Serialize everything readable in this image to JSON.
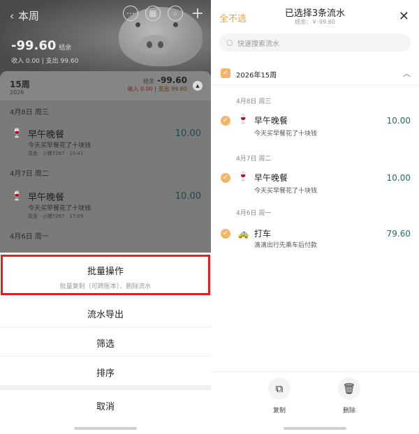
{
  "left": {
    "header": {
      "back_label": "本周",
      "balance": "-99.60",
      "balance_tag": "结余",
      "income": "收入 0.00",
      "expense": "支出 99.60",
      "icons": [
        "more-icon",
        "calendar-icon",
        "search-icon",
        "add-icon"
      ]
    },
    "week": {
      "title": "15周",
      "year": "2026",
      "balance_tag": "结余",
      "balance": "-99.60",
      "income": "收入 0.00",
      "expense": "支出 99.60"
    },
    "days": [
      {
        "label": "4月8日 周三",
        "entry": {
          "title": "早午晚餐",
          "note": "今天买早餐花了十块钱",
          "meta": "现金 · 小猪7287 · 10:41",
          "amount": "10.00"
        }
      },
      {
        "label": "4月7日 周二",
        "entry": {
          "title": "早午晚餐",
          "note": "今天买早餐花了十块钱",
          "meta": "现金 · 小猪7287 · 17:09",
          "amount": "10.00"
        }
      },
      {
        "label": "4月6日 周一"
      }
    ],
    "sheet": {
      "batch": "批量操作",
      "batch_desc": "批量复制（可跨账本）、删除流水",
      "export": "流水导出",
      "filter": "筛选",
      "sort": "排序",
      "cancel": "取消"
    }
  },
  "right": {
    "deselect_all": "全不选",
    "title": "已选择3条流水",
    "subtitle": "结余：￥-99.60",
    "search_placeholder": "快速搜索流水",
    "group_label": "2026年15周",
    "days": [
      {
        "label": "4月8日 周三",
        "title": "早午晚餐",
        "note": "今天买早餐花了十块钱",
        "amount": "10.00",
        "icon": "food-icon"
      },
      {
        "label": "4月7日 周二",
        "title": "早午晚餐",
        "note": "今天买早餐花了十块钱",
        "amount": "10.00",
        "icon": "food-icon"
      },
      {
        "label": "4月6日 周一",
        "title": "打车",
        "note": "滴滴出行先乘车后付款",
        "amount": "79.60",
        "icon": "taxi-icon"
      }
    ],
    "actions": {
      "copy": "复制",
      "delete": "删除"
    }
  },
  "colors": {
    "accent": "#f0a336",
    "check": "#f4b56a",
    "highlight": "#e02020",
    "amount": "#2a6670"
  }
}
